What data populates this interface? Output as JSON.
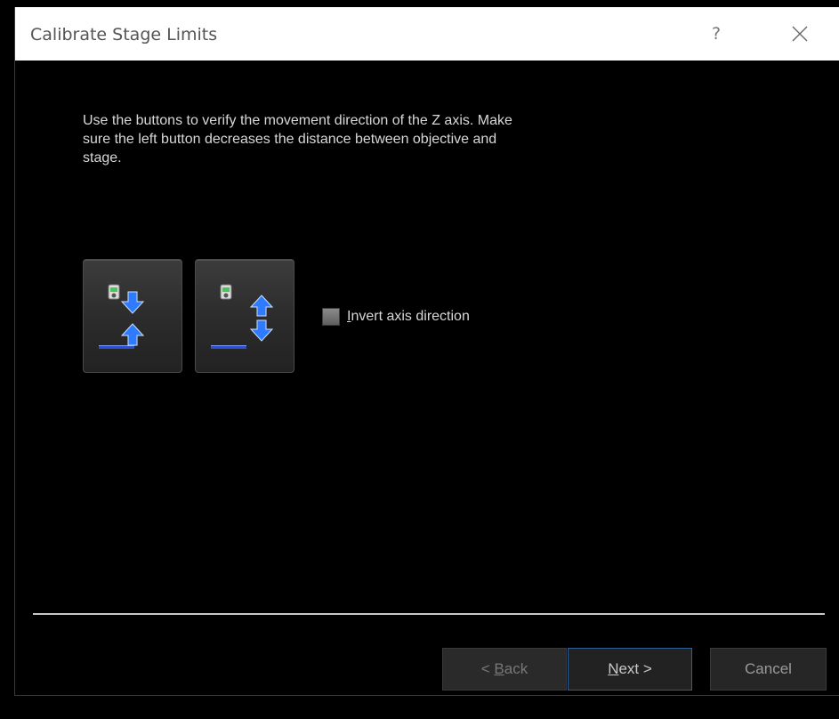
{
  "window": {
    "title": "Calibrate Stage Limits",
    "help_label": "?"
  },
  "main": {
    "instruction": "Use the buttons to verify the movement direction of the Z axis. Make sure the left button decreases the distance between objective and stage.",
    "invert_checkbox": {
      "label_accel": "I",
      "label_rest": "nvert axis direction",
      "checked": false
    },
    "buttons": [
      {
        "name": "move-closer",
        "icon": "z-decrease-distance-icon"
      },
      {
        "name": "move-apart",
        "icon": "z-increase-distance-icon"
      }
    ]
  },
  "footer": {
    "back_prefix": "< ",
    "back_accel": "B",
    "back_rest": "ack",
    "next_accel": "N",
    "next_rest": "ext >",
    "cancel_label": "Cancel"
  },
  "colors": {
    "background": "#000000",
    "titlebar": "#ffffff",
    "arrow_blue": "#2f7bff",
    "stage_line": "#2a4fd8",
    "objective_green": "#49c65a",
    "next_border": "#2f5f96"
  }
}
